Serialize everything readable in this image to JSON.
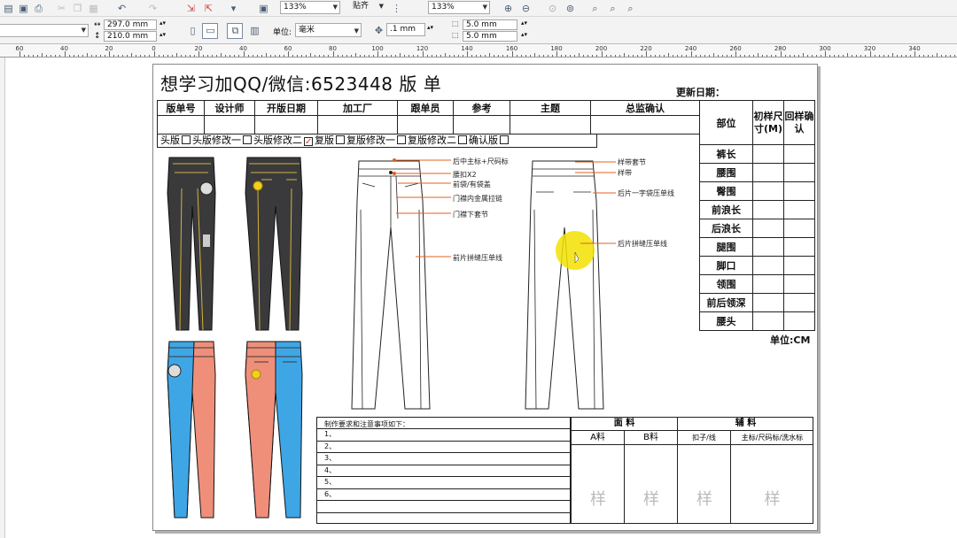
{
  "toolbar": {
    "zoom1": "133%",
    "snap": "贴齐",
    "zoom2": "133%",
    "width": "297.0 mm",
    "height": "210.0 mm",
    "units_label": "单位:",
    "units_value": "毫米",
    "nudge": ".1 mm",
    "dup_x": "5.0 mm",
    "dup_y": "5.0 mm"
  },
  "ruler": [
    "60",
    "40",
    "20",
    "0",
    "20",
    "40",
    "60",
    "80",
    "100",
    "120",
    "140",
    "160",
    "180",
    "200",
    "220",
    "240",
    "260",
    "280",
    "300",
    "320",
    "340"
  ],
  "sheet": {
    "title": "想学习加QQ/微信:6523448  版          单",
    "update_date": "更新日期：",
    "header_cols": [
      "版单号",
      "设计师",
      "开版日期",
      "加工厂",
      "跟单员",
      "参考",
      "主题",
      "总监确认"
    ],
    "checklist": [
      {
        "label": "头版",
        "checked": false
      },
      {
        "label": "头版修改一",
        "checked": false
      },
      {
        "label": "头版修改二",
        "checked": true
      },
      {
        "label": "复版",
        "checked": false
      },
      {
        "label": "复版修改一",
        "checked": false
      },
      {
        "label": "复版修改二",
        "checked": false
      },
      {
        "label": "确认版",
        "checked": false
      }
    ],
    "size_table": {
      "col_part": "部位",
      "col_size": "初样尺寸(M)",
      "col_confirm": "回样确认",
      "rows": [
        "裤长",
        "腰围",
        "臀围",
        "前浪长",
        "后浪长",
        "腿围",
        "脚口",
        "领围",
        "前后领深",
        "腰头"
      ]
    },
    "unit": "单位:CM",
    "front_annotations": [
      "后中主标+尺码标",
      "腰扣X2",
      "前袋/有袋盖",
      "门襟内金属拉链",
      "门襟下套节",
      "前片拼缝压单线"
    ],
    "back_annotations": [
      "样带套节",
      "样带",
      "后片一字袋压单线",
      "后片拼缝压单线"
    ],
    "notes_title": "制作要求和注意事项如下：",
    "notes": [
      "1、",
      "2、",
      "3、",
      "4、",
      "5、",
      "6、"
    ],
    "fabric": "面      料",
    "accessory": "辅      料",
    "fabric_cols": [
      "A料",
      "B料"
    ],
    "accessory_cols": [
      "扣子/线",
      "主标/尺码标/洗水标"
    ],
    "sample_mark": "样"
  }
}
